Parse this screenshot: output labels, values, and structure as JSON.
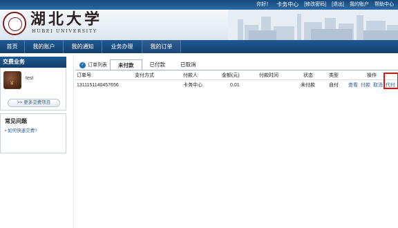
{
  "topbar": {
    "greeting": "你好！",
    "user": "卡务中心",
    "change_password": "[修改密码]",
    "logout": "[退出]",
    "my_account": "我的账户",
    "help_center": "帮助中心"
  },
  "logo": {
    "name": "湖北大学",
    "subtitle": "HUBEI UNIVERSITY"
  },
  "nav": {
    "items": [
      "首页",
      "我的账户",
      "我的通知",
      "业务办理",
      "我的订单"
    ],
    "active_index": 4
  },
  "sidebar": {
    "title": "交费业务",
    "user_name": "test",
    "more_button": ">> 更多交费项目",
    "faq_title": "常见问题",
    "faq_link": "如何快速交费?"
  },
  "main": {
    "list_label": "订单列表",
    "tabs": [
      "未付款",
      "已付款",
      "已取消"
    ],
    "active_tab": 0,
    "columns": [
      "订单号",
      "支付方式",
      "付款人",
      "金额(元)",
      "付款时间",
      "状态",
      "类型",
      "操作"
    ],
    "rows": [
      {
        "order_no": "1311151140457656",
        "pay_method": "",
        "payer": "卡务中心",
        "amount": "0.01",
        "pay_time": "",
        "status": "未付款",
        "type": "自付",
        "actions": [
          "查看",
          "付款",
          "取消",
          "代付"
        ]
      }
    ]
  },
  "colors": {
    "nav_blue": "#1f5a92",
    "link_blue": "#2b5d90",
    "highlight_red": "#e01010"
  }
}
